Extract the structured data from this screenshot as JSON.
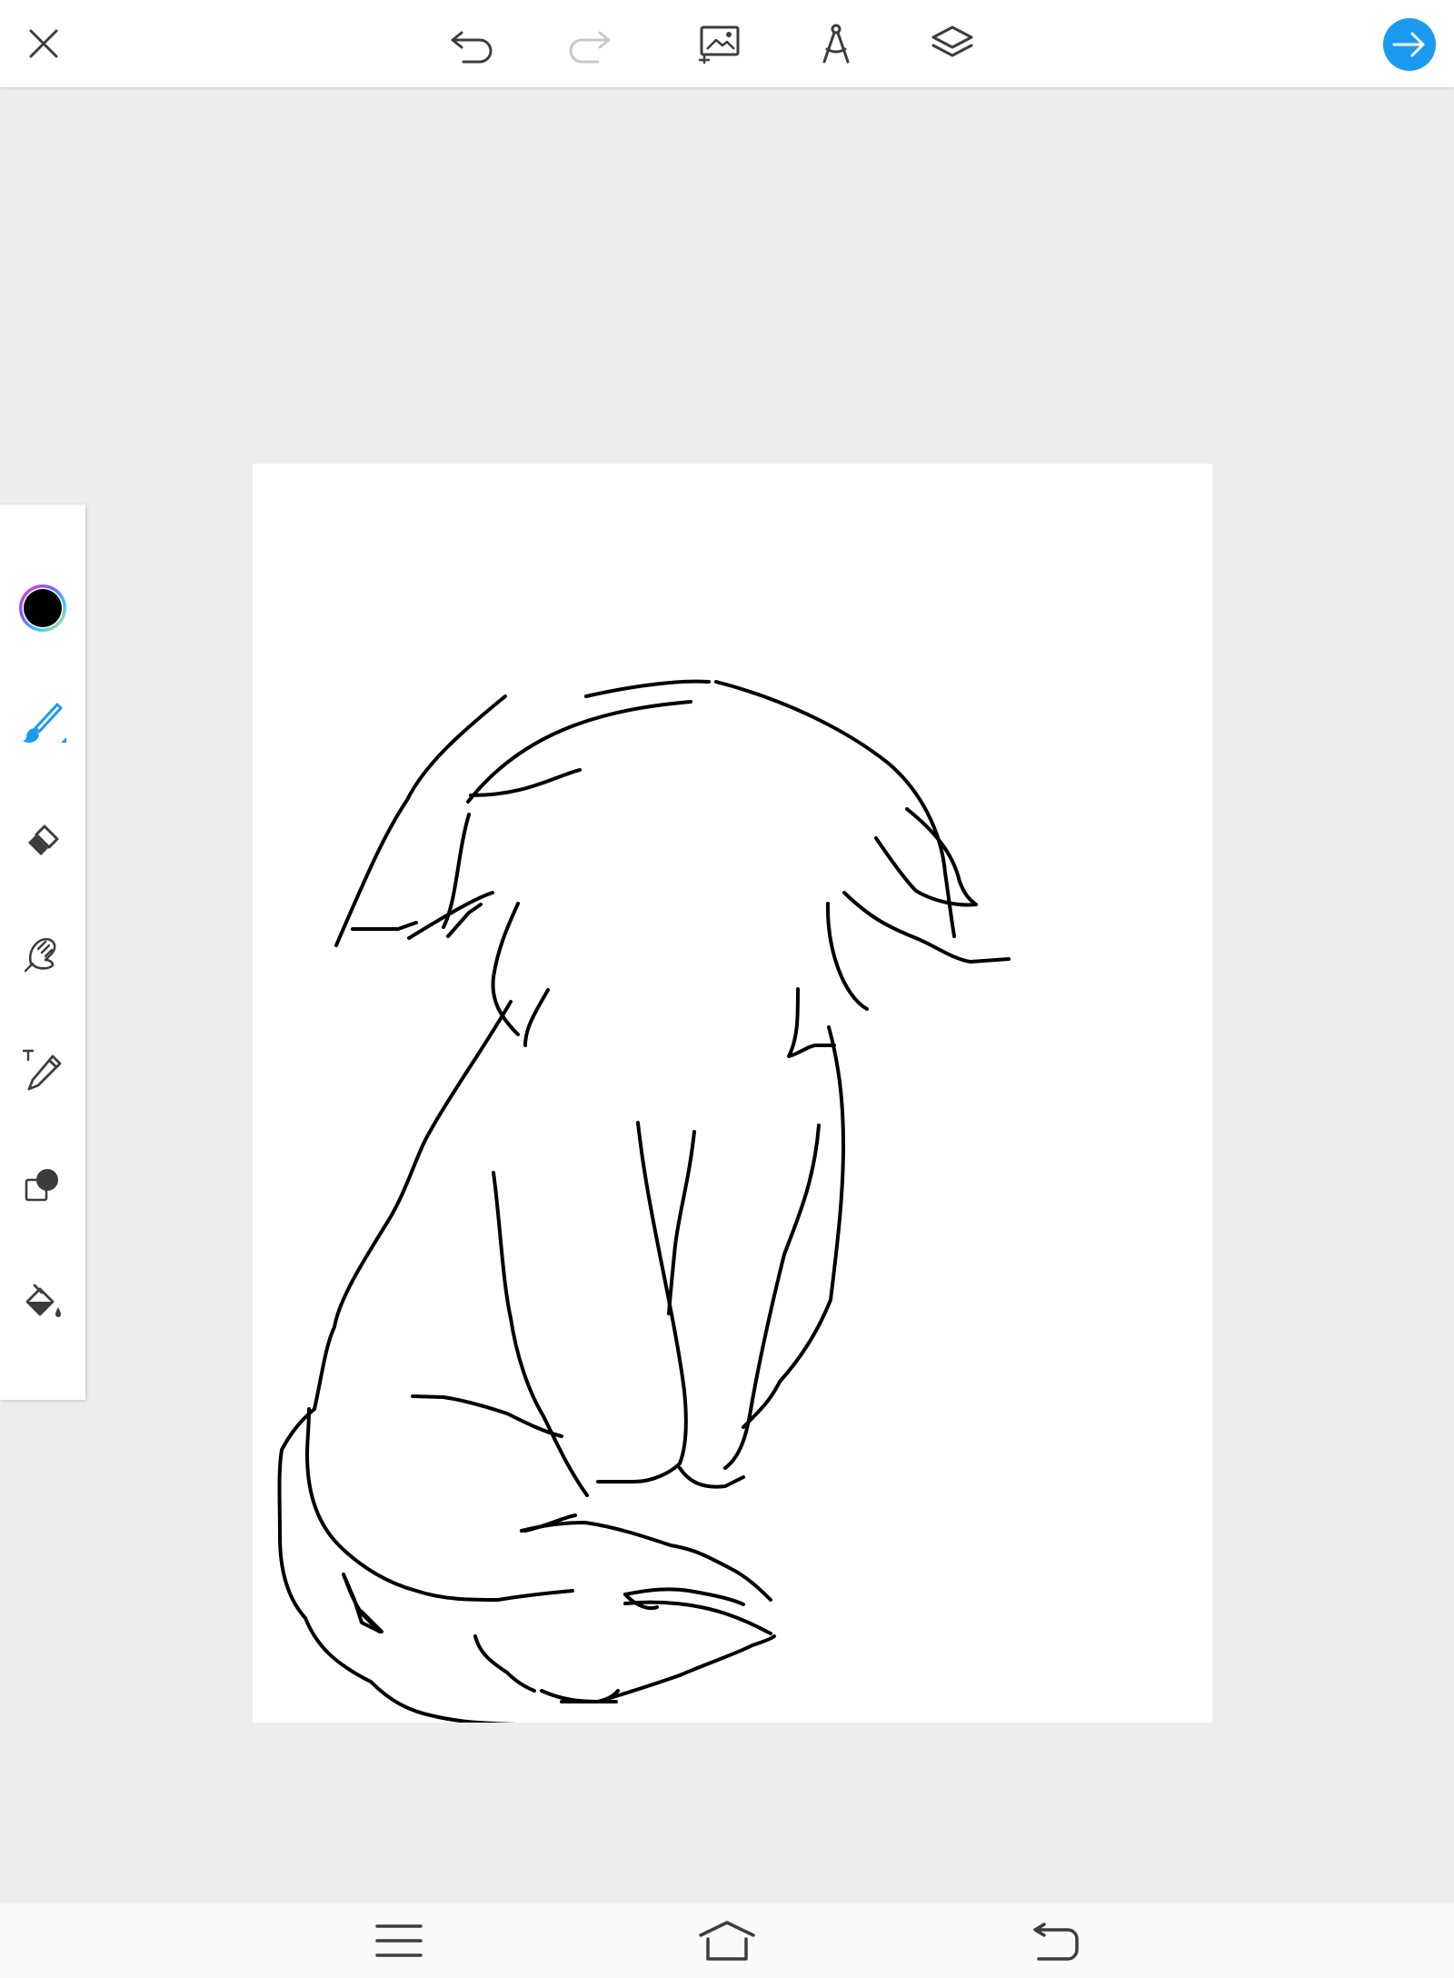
{
  "colors": {
    "accent": "#1a9bf0",
    "icon": "#3c3c3c",
    "icon_disabled": "#c8c8c8",
    "current_color": "#000000",
    "canvas_background": "#ededed",
    "artboard": "#ffffff"
  },
  "top_toolbar": {
    "icons": [
      "close-icon",
      "undo-icon",
      "redo-icon",
      "add-image-icon",
      "drawing-guide-icon",
      "layers-icon",
      "next-arrow-icon"
    ]
  },
  "left_toolbar": {
    "tools": [
      "color-picker",
      "brush-tool",
      "eraser-tool",
      "smudge-tool",
      "text-tool",
      "blend-tool",
      "fill-tool"
    ],
    "active_tool": "brush-tool"
  },
  "bottom_nav": {
    "icons": [
      "menu-icon",
      "home-icon",
      "back-icon"
    ]
  }
}
